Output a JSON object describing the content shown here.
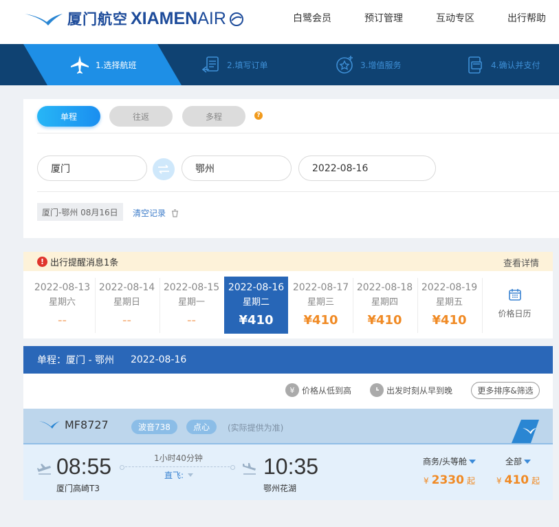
{
  "header": {
    "logo_cn": "厦门航空",
    "logo_en_bold": "XIAMEN",
    "logo_en_light": "AIR",
    "nav": [
      "白鹭会员",
      "预订管理",
      "互动专区",
      "出行帮助"
    ]
  },
  "steps": [
    {
      "label": "1.选择航班",
      "icon": "plane-icon",
      "active": true
    },
    {
      "label": "2.填写订单",
      "icon": "form-icon",
      "active": false
    },
    {
      "label": "3.增值服务",
      "icon": "star-plus-icon",
      "active": false
    },
    {
      "label": "4.确认并支付",
      "icon": "payment-icon",
      "active": false
    }
  ],
  "search": {
    "trip_types": [
      "单程",
      "往返",
      "多程"
    ],
    "selected_trip": "单程",
    "from": "厦门",
    "to": "鄂州",
    "date": "2022-08-16",
    "history_tag": "厦门-鄂州 08月16日",
    "clear_label": "清空记录"
  },
  "notice": {
    "text": "出行提醒消息1条",
    "detail_label": "查看详情"
  },
  "dates": [
    {
      "date": "2022-08-13",
      "weekday": "星期六",
      "price": "--"
    },
    {
      "date": "2022-08-14",
      "weekday": "星期日",
      "price": "--"
    },
    {
      "date": "2022-08-15",
      "weekday": "星期一",
      "price": "--"
    },
    {
      "date": "2022-08-16",
      "weekday": "星期二",
      "price": "¥410",
      "active": true
    },
    {
      "date": "2022-08-17",
      "weekday": "星期三",
      "price": "¥410"
    },
    {
      "date": "2022-08-18",
      "weekday": "星期四",
      "price": "¥410"
    },
    {
      "date": "2022-08-19",
      "weekday": "星期五",
      "price": "¥410"
    }
  ],
  "calendar_label": "价格日历",
  "result": {
    "title": "单程：厦门 - 鄂州",
    "date": "2022-08-16",
    "sort_price": "价格从低到高",
    "sort_time": "出发时刻从早到晚",
    "filter_label": "更多排序&筛选"
  },
  "flight": {
    "number": "MF8727",
    "aircraft": "波音738",
    "meal": "点心",
    "note": "(实际提供为准)",
    "dep_time": "08:55",
    "dep_airport": "厦门高崎T3",
    "arr_time": "10:35",
    "arr_airport": "鄂州花湖",
    "duration": "1小时40分钟",
    "direct_label": "直飞:",
    "cabin1_label": "商务/头等舱",
    "cabin1_currency": "¥",
    "cabin1_price": "2330",
    "cabin1_suffix": "起",
    "cabin2_label": "全部",
    "cabin2_currency": "¥",
    "cabin2_price": "410",
    "cabin2_suffix": "起"
  },
  "colors": {
    "brand_blue": "#1d4b9a",
    "step_bar": "#0f4272",
    "active_blue": "#1e8fe6",
    "price_orange": "#f08a24"
  }
}
